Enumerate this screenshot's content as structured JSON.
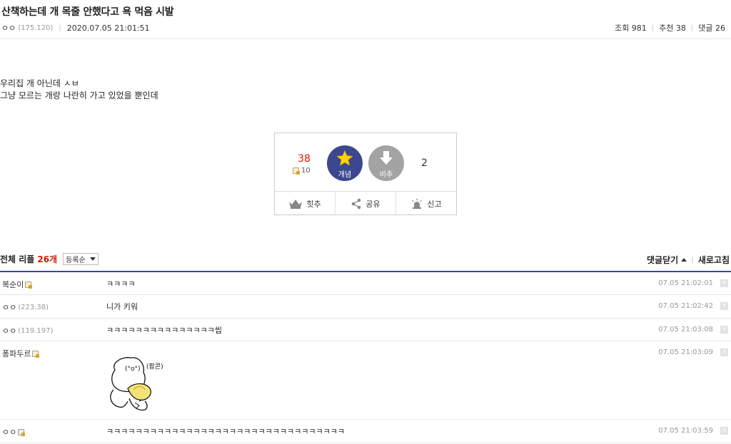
{
  "post": {
    "title": "산책하는데 개 목줄 안했다고 욕 먹음 시발",
    "author": "ㅇㅇ",
    "author_ip": "(175.120)",
    "date": "2020.07.05 21:01:51",
    "views_label": "조회 981",
    "recommend_label": "추천 38",
    "comments_label": "댓글 26",
    "body": [
      "우리집 개 아닌데 ㅅㅂ",
      "그냥 모르는 개랑 나란히 가고 있었을 뿐인데"
    ]
  },
  "vote": {
    "up_count": "38",
    "up_sub_count": "10",
    "up_label": "개념",
    "down_label": "비추",
    "down_count": "2",
    "buttons": [
      "힛추",
      "공유",
      "신고"
    ],
    "colors": {
      "up": "#3b4890",
      "down": "#a3a3a3",
      "up_count": "#d31900"
    }
  },
  "comments_header": {
    "label": "전체 리플",
    "count": "26개",
    "sort": "등록순",
    "collapse": "댓글닫기",
    "refresh": "새로고침"
  },
  "comments": [
    {
      "nick": "복순이",
      "ip": "",
      "has_icon": true,
      "text": "ㅋㅋㅋㅋ",
      "date": "07.05 21:02:01"
    },
    {
      "nick": "ㅇㅇ",
      "ip": "(223.38)",
      "has_icon": false,
      "text": "니가 키워",
      "date": "07.05 21:02:42"
    },
    {
      "nick": "ㅇㅇ",
      "ip": "(119.197)",
      "has_icon": false,
      "text": "ㅋㅋㅋㅋㅋㅋㅋㅋㅋㅋㅋㅋㅋㅋㅋ씹",
      "date": "07.05 21:03:08"
    },
    {
      "nick": "퐁파두르",
      "ip": "",
      "has_icon": true,
      "text": "",
      "image_text": "(팝콘)",
      "date": "07.05 21:03:09"
    },
    {
      "nick": "ㅇㅇ",
      "ip": "",
      "has_icon": true,
      "text": "ㅋㅋㅋㅋㅋㅋㅋㅋㅋㅋㅋㅋㅋㅋㅋㅋㅋㅋㅋㅋㅋㅋㅋㅋㅋㅋㅋㅋㅋㅋㅋㅋㅋ",
      "date": "07.05 21:03:59"
    }
  ]
}
